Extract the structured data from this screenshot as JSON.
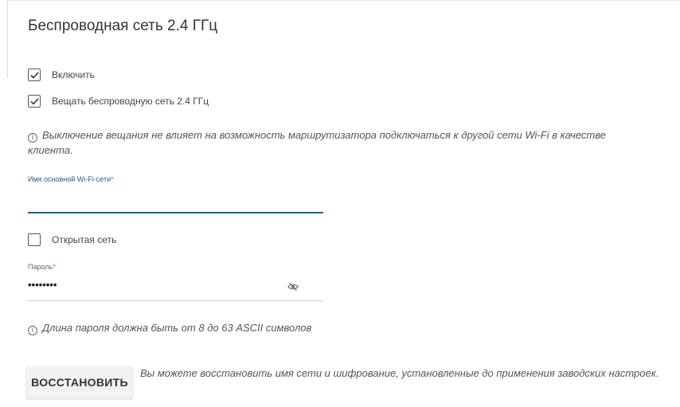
{
  "section": {
    "title": "Беспроводная сеть 2.4 ГГц"
  },
  "enable": {
    "label": "Включить",
    "checked": true
  },
  "broadcast": {
    "label": "Вещать беспроводную сеть 2.4 ГГц",
    "checked": true
  },
  "broadcast_info": {
    "icon": "info-icon",
    "text": "Выключение вещания не влияет на возможность маршрутизатора подключаться к другой сети Wi-Fi в качестве клиента."
  },
  "ssid": {
    "label": "Имя основной Wi-Fi-сети",
    "required_mark": "*",
    "value": "",
    "placeholder": ""
  },
  "open_network": {
    "label": "Открытая сеть",
    "checked": false
  },
  "password": {
    "label": "Пароль",
    "required_mark": "*",
    "value": "••••••••",
    "toggle_icon": "eye-off-icon"
  },
  "password_info": {
    "icon": "info-icon",
    "text": "Длина пароля должна быть от 8 до 63 ASCII символов"
  },
  "restore": {
    "button_label": "ВОССТАНОВИТЬ",
    "description": "Вы можете восстановить имя сети и шифрование, установленные до применения заводских настроек."
  },
  "colors": {
    "accent": "#1e5f88",
    "required": "#e0502d",
    "text": "#333333",
    "muted": "#555555"
  }
}
